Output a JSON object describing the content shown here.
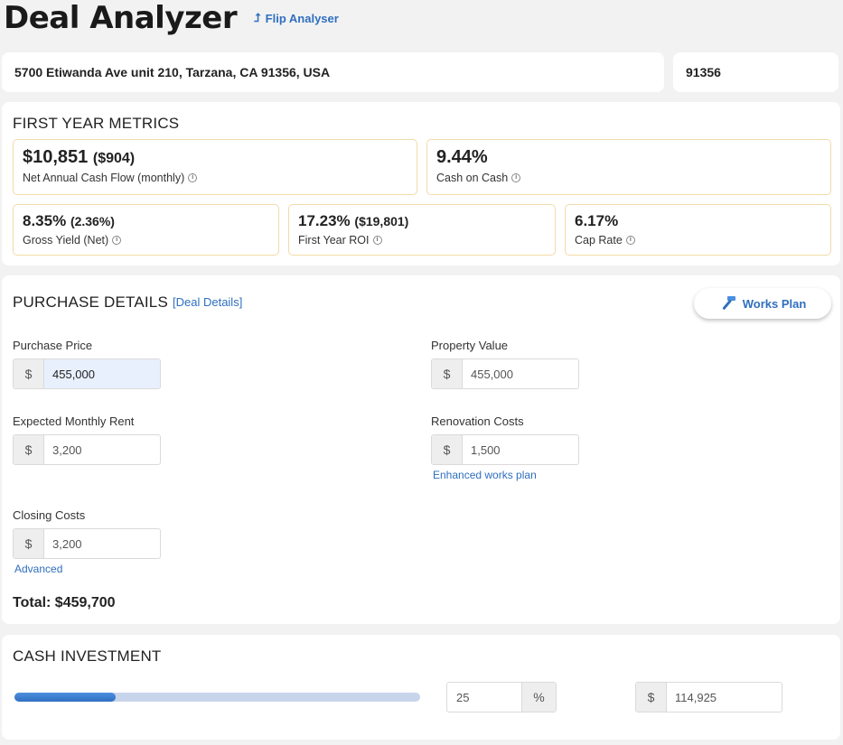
{
  "header": {
    "title": "Deal Analyzer",
    "flip_link": "Flip Analyser"
  },
  "address": {
    "full": "5700 Etiwanda Ave unit 210, Tarzana, CA 91356, USA",
    "zip": "91356"
  },
  "metrics": {
    "section_title": "FIRST YEAR METRICS",
    "cash_flow": {
      "value": "$10,851",
      "sub": "($904)",
      "label": "Net Annual Cash Flow (monthly)"
    },
    "cash_on_cash": {
      "value": "9.44%",
      "label": "Cash on Cash"
    },
    "gross_yield": {
      "value": "8.35%",
      "sub": "(2.36%)",
      "label": "Gross Yield (Net)"
    },
    "roi": {
      "value": "17.23%",
      "sub": "($19,801)",
      "label": "First Year ROI"
    },
    "cap_rate": {
      "value": "6.17%",
      "label": "Cap Rate"
    },
    "info_glyph": "i"
  },
  "purchase": {
    "section_title": "PURCHASE DETAILS",
    "deal_details_link": "[Deal Details]",
    "works_plan_button": "Works Plan",
    "currency_symbol": "$",
    "purchase_price": {
      "label": "Purchase Price",
      "value": "455,000"
    },
    "property_value": {
      "label": "Property Value",
      "value": "455,000"
    },
    "monthly_rent": {
      "label": "Expected Monthly Rent",
      "value": "3,200"
    },
    "renovation": {
      "label": "Renovation Costs",
      "value": "1,500",
      "link": "Enhanced works plan"
    },
    "closing": {
      "label": "Closing Costs",
      "value": "3,200",
      "link": "Advanced"
    },
    "total": "Total: $459,700"
  },
  "cash_investment": {
    "section_title": "CASH INVESTMENT",
    "percent": "25",
    "percent_symbol": "%",
    "currency_symbol": "$",
    "amount": "114,925",
    "slider_fraction": 0.25
  },
  "colors": {
    "accent": "#2f6fbf",
    "metric_border": "#f2dba9"
  }
}
